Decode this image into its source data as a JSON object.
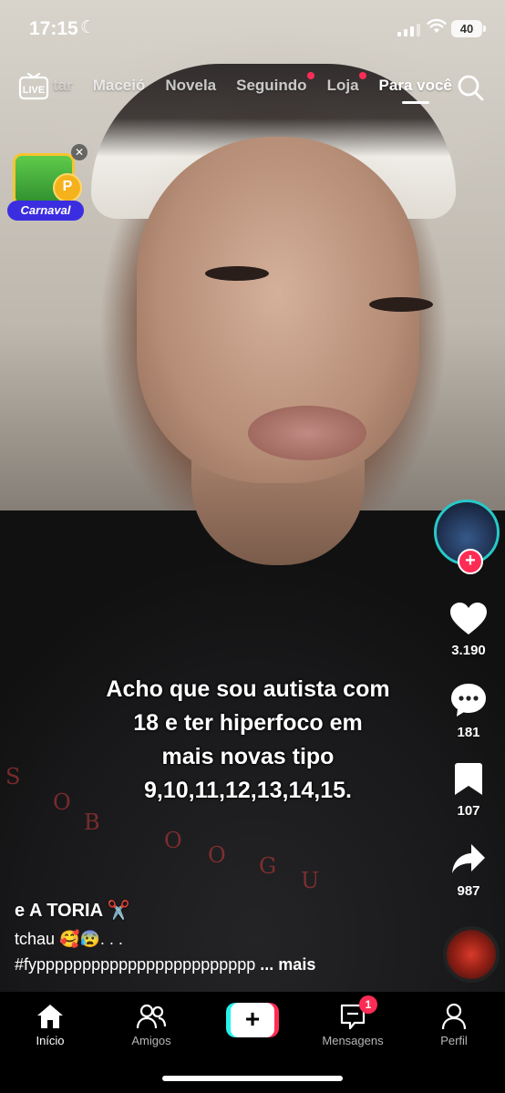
{
  "status_bar": {
    "time": "17:15",
    "battery": "40"
  },
  "top_nav": {
    "live_label": "LIVE",
    "tabs": [
      {
        "label": "tar",
        "state": "faded"
      },
      {
        "label": "Maceió"
      },
      {
        "label": "Novela"
      },
      {
        "label": "Seguindo",
        "dot": true
      },
      {
        "label": "Loja",
        "dot": true
      },
      {
        "label": "Para você",
        "state": "active"
      }
    ]
  },
  "promo": {
    "label": "Carnaval",
    "coin": "P"
  },
  "video": {
    "overlay_text": [
      "Acho que sou autista com",
      "18 e ter  hiperfoco em",
      "mais novas tipo",
      "9,10,11,12,13,14,15."
    ],
    "shirt_print": [
      "S",
      "O",
      "B",
      "O",
      "U",
      "G",
      "O"
    ]
  },
  "actions": {
    "likes": "3.190",
    "comments": "181",
    "saves": "107",
    "shares": "987"
  },
  "caption": {
    "author": "e A TORIA ✂️",
    "line1": "tchau 🥰😰. . .",
    "line2": "#fypppppppppppppppppppppppp",
    "more": "... mais"
  },
  "bottom_nav": {
    "home": "Início",
    "friends": "Amigos",
    "create": "+",
    "inbox": "Mensagens",
    "inbox_badge": "1",
    "profile": "Perfil"
  },
  "colors": {
    "accent": "#fe2c55",
    "cyan": "#25f4ee"
  }
}
